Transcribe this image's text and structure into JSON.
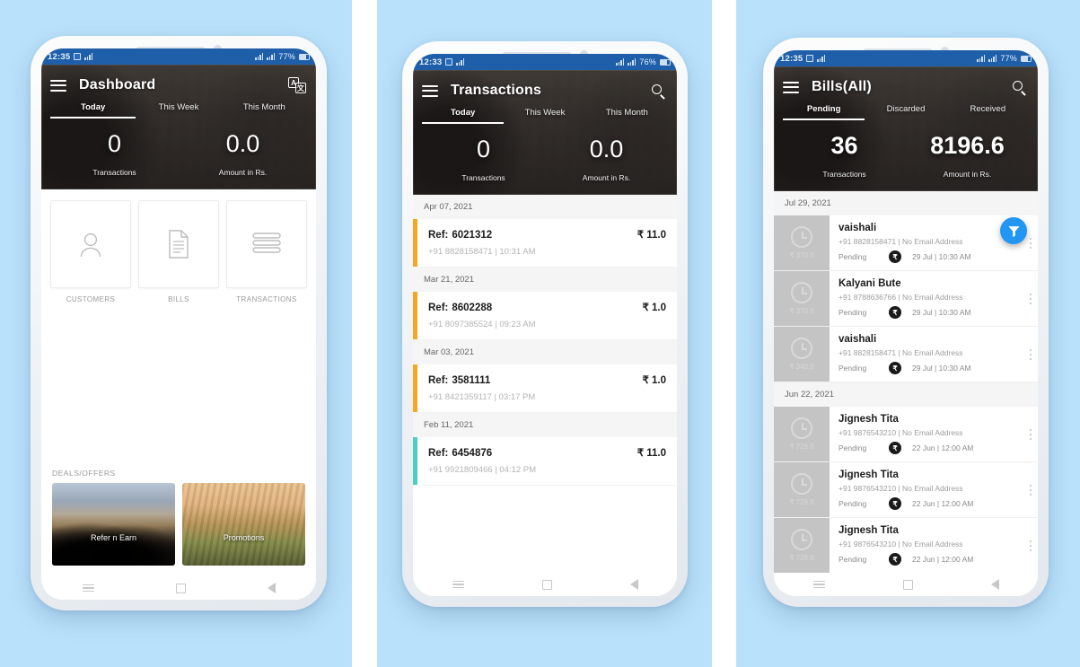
{
  "background": {
    "page_color": "#b9e1fb",
    "gutter_color": "#ffffff"
  },
  "panel1": {
    "statusbar": {
      "time": "12:35",
      "battery": "77%"
    },
    "appbar": {
      "title": "Dashboard",
      "menu_icon": "hamburger-icon",
      "action_icon": "translate-icon"
    },
    "tabs": [
      {
        "label": "Today",
        "active": true
      },
      {
        "label": "This Week",
        "active": false
      },
      {
        "label": "This Month",
        "active": false
      }
    ],
    "stats": [
      {
        "value": "0",
        "label": "Transactions"
      },
      {
        "value": "0.0",
        "label": "Amount in Rs."
      }
    ],
    "shortcuts": [
      {
        "label": "CUSTOMERS",
        "icon": "person-icon"
      },
      {
        "label": "BILLS",
        "icon": "document-icon"
      },
      {
        "label": "TRANSACTIONS",
        "icon": "list-lines-icon"
      }
    ],
    "deals_title": "DEALS/OFFERS",
    "deals": [
      {
        "caption": "Refer n Earn"
      },
      {
        "caption": "Promotions"
      }
    ]
  },
  "panel2": {
    "statusbar": {
      "time": "12:33",
      "battery": "76%"
    },
    "appbar": {
      "title": "Transactions",
      "menu_icon": "hamburger-icon",
      "action_icon": "search-icon"
    },
    "tabs": [
      {
        "label": "Today",
        "active": true
      },
      {
        "label": "This Week",
        "active": false
      },
      {
        "label": "This Month",
        "active": false
      }
    ],
    "stats": [
      {
        "value": "0",
        "label": "Transactions"
      },
      {
        "value": "0.0",
        "label": "Amount in Rs."
      }
    ],
    "groups": [
      {
        "date": "Apr 07, 2021",
        "rows": [
          {
            "ref_label": "Ref:",
            "ref": "6021312",
            "amount": "₹ 11.0",
            "phone": "+91 8828158471",
            "time": "10:31 AM",
            "accent": "#f5a623"
          }
        ]
      },
      {
        "date": "Mar 21, 2021",
        "rows": [
          {
            "ref_label": "Ref:",
            "ref": "8602288",
            "amount": "₹ 1.0",
            "phone": "+91 8097385524",
            "time": "09:23 AM",
            "accent": "#f5a623"
          }
        ]
      },
      {
        "date": "Mar 03, 2021",
        "rows": [
          {
            "ref_label": "Ref:",
            "ref": "3581111",
            "amount": "₹ 1.0",
            "phone": "+91 8421359117",
            "time": "03:17 PM",
            "accent": "#f5a623"
          }
        ]
      },
      {
        "date": "Feb 11, 2021",
        "rows": [
          {
            "ref_label": "Ref:",
            "ref": "6454876",
            "amount": "₹ 11.0",
            "phone": "+91 9921809466",
            "time": "04:12 PM",
            "accent": "#4ecdc4"
          }
        ]
      }
    ]
  },
  "panel3": {
    "statusbar": {
      "time": "12:35",
      "battery": "77%"
    },
    "appbar": {
      "title": "Bills(All)",
      "menu_icon": "hamburger-icon",
      "action_icon": "search-icon"
    },
    "tabs": [
      {
        "label": "Pending",
        "active": true
      },
      {
        "label": "Discarded",
        "active": false
      },
      {
        "label": "Received",
        "active": false
      }
    ],
    "stats": [
      {
        "value": "36",
        "label": "Transactions"
      },
      {
        "value": "8196.6",
        "label": "Amount in Rs."
      }
    ],
    "fab": {
      "icon": "filter-icon",
      "color": "#2196f3"
    },
    "groups": [
      {
        "date": "Jul 29, 2021",
        "rows": [
          {
            "name": "vaishali",
            "thumb_amount": "₹ 370.0",
            "contact": "+91 8828158471 | No Email Address",
            "status": "Pending",
            "badge": "₹",
            "date": "29 Jul | 10:30 AM"
          },
          {
            "name": "Kalyani Bute",
            "thumb_amount": "₹ 370.0",
            "contact": "+91 8788636766 | No Email Address",
            "status": "Pending",
            "badge": "₹",
            "date": "29 Jul | 10:30 AM"
          },
          {
            "name": "vaishali",
            "thumb_amount": "₹ 340.0",
            "contact": "+91 8828158471 | No Email Address",
            "status": "Pending",
            "badge": "₹",
            "date": "29 Jul | 10:30 AM"
          }
        ]
      },
      {
        "date": "Jun 22, 2021",
        "rows": [
          {
            "name": "Jignesh Tita",
            "thumb_amount": "₹ 729.0",
            "contact": "+91 9876543210 | No Email Address",
            "status": "Pending",
            "badge": "₹",
            "date": "22 Jun | 12:00 AM"
          },
          {
            "name": "Jignesh Tita",
            "thumb_amount": "₹ 729.0",
            "contact": "+91 9876543210 | No Email Address",
            "status": "Pending",
            "badge": "₹",
            "date": "22 Jun | 12:00 AM"
          },
          {
            "name": "Jignesh Tita",
            "thumb_amount": "₹ 729.0",
            "contact": "+91 9876543210 | No Email Address",
            "status": "Pending",
            "badge": "₹",
            "date": "22 Jun | 12:00 AM"
          }
        ]
      }
    ]
  },
  "navbar": {
    "recents": "recents-icon",
    "home": "home-icon",
    "back": "back-icon"
  }
}
